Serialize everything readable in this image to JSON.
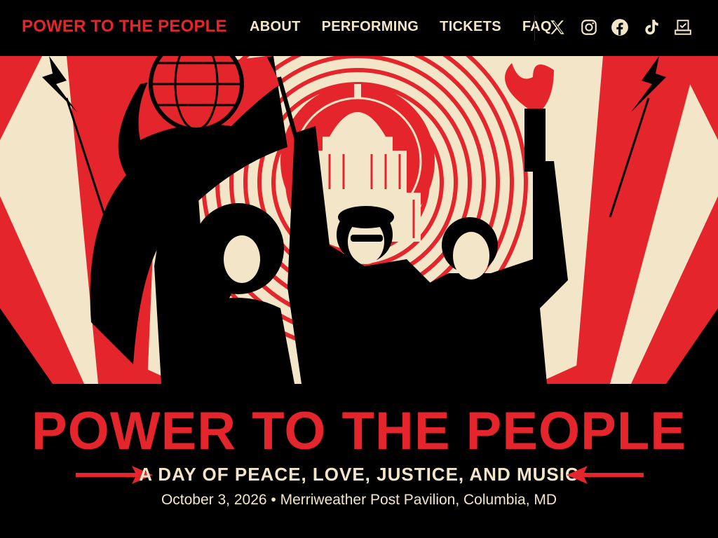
{
  "header": {
    "logo_text": "POWER TO THE PEOPLE",
    "nav": [
      {
        "label": "ABOUT"
      },
      {
        "label": "PERFORMING"
      },
      {
        "label": "TICKETS"
      },
      {
        "label": "FAQ"
      }
    ],
    "social_icons": [
      "x-icon",
      "instagram-icon",
      "facebook-icon",
      "tiktok-icon",
      "ballot-box-icon"
    ]
  },
  "hero": {
    "title": "POWER TO THE PEOPLE",
    "tagline": "A DAY OF PEACE, LOVE, JUSTICE, AND MUSIC",
    "event_info": "October 3, 2026 • Merriweather Post Pavilion, Columbia, MD"
  },
  "colors": {
    "accent": "#e4252b",
    "cream": "#f3e6c8",
    "black": "#000000"
  }
}
